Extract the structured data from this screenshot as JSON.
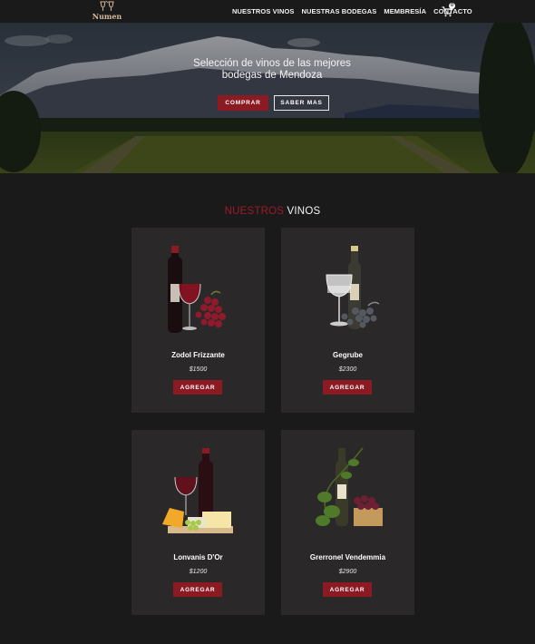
{
  "brand": {
    "logo_text": "Numen"
  },
  "nav": {
    "links": [
      "NUESTROS VINOS",
      "NUESTRAS BODEGAS",
      "MEMBRESÍA",
      "CONTACTO"
    ],
    "cart_icon": "cart-icon",
    "cart_count": "0"
  },
  "hero": {
    "title_line1": "Selección de vinos de las mejores",
    "title_line2": "bodegas de Mendoza",
    "buttons": {
      "primary": "COMPRAR",
      "secondary": "SABER MAS"
    }
  },
  "section": {
    "title_part1": "NUESTROS",
    "title_part2": "VINOS"
  },
  "products": [
    {
      "name": "Zodol Frizzante",
      "price": "$1500",
      "button": "AGREGAR"
    },
    {
      "name": "Gegrube",
      "price": "$2300",
      "button": "AGREGAR"
    },
    {
      "name": "Lonvanis D'Or",
      "price": "$1200",
      "button": "AGREGAR"
    },
    {
      "name": "Grerronel Vendemmia",
      "price": "$2900",
      "button": "AGREGAR"
    }
  ],
  "colors": {
    "accent": "#8b1a22",
    "background": "#1b1a1b",
    "card": "#2a2829"
  }
}
